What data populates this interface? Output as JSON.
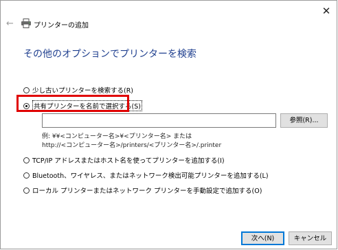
{
  "window": {
    "title": "プリンターの追加",
    "close_glyph": "✕",
    "back_glyph": "←"
  },
  "heading": "その他のオプションでプリンターを検索",
  "options": [
    {
      "label": "少し古いプリンターを検索する(R)",
      "checked": false
    },
    {
      "label": "共有プリンターを名前で選択する(S)",
      "checked": true
    },
    {
      "label": "TCP/IP アドレスまたはホスト名を使ってプリンターを追加する(I)",
      "checked": false
    },
    {
      "label": "Bluetooth、ワイヤレス、またはネットワーク検出可能プリンターを追加する(L)",
      "checked": false
    },
    {
      "label": "ローカル プリンターまたはネットワーク プリンターを手動設定で追加する(O)",
      "checked": false
    }
  ],
  "printer_name_input": {
    "value": ""
  },
  "browse_button": "参照(R)...",
  "example": {
    "line1": "例: ¥¥<コンピューター名>¥<プリンター名> または",
    "line2": "http://<コンピューター名>/printers/<プリンター名>/.printer"
  },
  "buttons": {
    "next": "次へ(N)",
    "cancel": "キャンセル"
  },
  "colors": {
    "heading": "#1f3f8f",
    "highlight": "#e00000",
    "primary_border": "#0078d7"
  }
}
